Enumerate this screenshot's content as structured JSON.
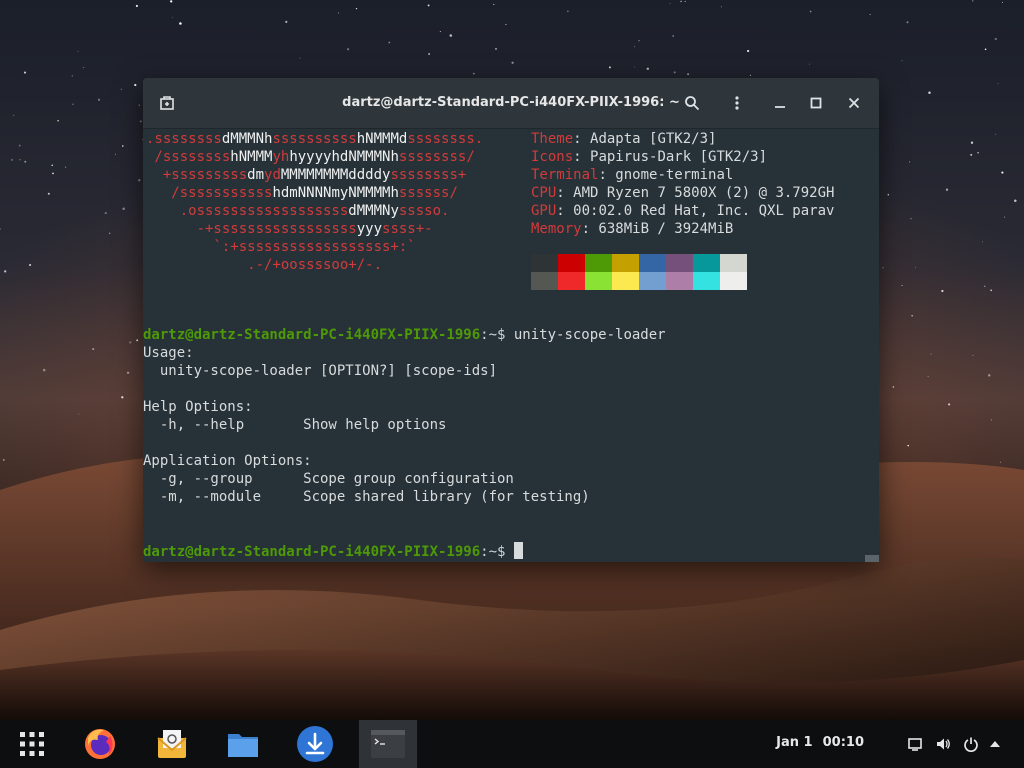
{
  "window": {
    "title": "dartz@dartz-Standard-PC-i440FX-PIIX-1996: ~"
  },
  "neofetch": {
    "logo_lines": [
      {
        "parts": [
          {
            "t": ".ssssssss",
            "c": "red"
          },
          {
            "t": "dMMMNh",
            "c": "white"
          },
          {
            "t": "ssssssssss",
            "c": "red"
          },
          {
            "t": "hNMMMd",
            "c": "white"
          },
          {
            "t": "ssssssss.",
            "c": "red"
          }
        ]
      },
      {
        "parts": [
          {
            "t": " /ssssssss",
            "c": "red"
          },
          {
            "t": "hNMMM",
            "c": "white"
          },
          {
            "t": "yh",
            "c": "red"
          },
          {
            "t": "hyyyyhdNMMMNh",
            "c": "white"
          },
          {
            "t": "ssssssss/",
            "c": "red"
          }
        ]
      },
      {
        "parts": [
          {
            "t": "  +sssssssss",
            "c": "red"
          },
          {
            "t": "dm",
            "c": "white"
          },
          {
            "t": "yd",
            "c": "red"
          },
          {
            "t": "MMMMMMMMddddy",
            "c": "white"
          },
          {
            "t": "ssssssss+",
            "c": "red"
          }
        ]
      },
      {
        "parts": [
          {
            "t": "   /sssssssssss",
            "c": "red"
          },
          {
            "t": "hdmNNNNmyNMMMMh",
            "c": "white"
          },
          {
            "t": "ssssss/",
            "c": "red"
          }
        ]
      },
      {
        "parts": [
          {
            "t": "    .ossssssssssssssssss",
            "c": "red"
          },
          {
            "t": "dMMMNy",
            "c": "white"
          },
          {
            "t": "sssso.",
            "c": "red"
          }
        ]
      },
      {
        "parts": [
          {
            "t": "      -+sssssssssssssssss",
            "c": "red"
          },
          {
            "t": "yyy",
            "c": "white"
          },
          {
            "t": "ssss+-",
            "c": "red"
          }
        ]
      },
      {
        "parts": [
          {
            "t": "        `:+ssssssssssssssssss+:`",
            "c": "red"
          }
        ]
      },
      {
        "parts": [
          {
            "t": "            .-/+oossssoo+/-.",
            "c": "red"
          }
        ]
      }
    ],
    "info": [
      {
        "label": "Theme",
        "value": ": Adapta [GTK2/3]"
      },
      {
        "label": "Icons",
        "value": ": Papirus-Dark [GTK2/3]"
      },
      {
        "label": "Terminal",
        "value": ": gnome-terminal"
      },
      {
        "label": "CPU",
        "value": ": AMD Ryzen 7 5800X (2) @ 3.792GH"
      },
      {
        "label": "GPU",
        "value": ": 00:02.0 Red Hat, Inc. QXL parav"
      },
      {
        "label": "Memory",
        "value": ": 638MiB / 3924MiB"
      }
    ],
    "palette_top": [
      "#2e3436",
      "#cc0000",
      "#4e9a06",
      "#c4a000",
      "#3465a4",
      "#75507b",
      "#06989a",
      "#d3d7cf"
    ],
    "palette_bottom": [
      "#555753",
      "#ef2929",
      "#8ae234",
      "#fce94f",
      "#729fcf",
      "#ad7fa8",
      "#34e2e2",
      "#eeeeec"
    ]
  },
  "terminal": {
    "prompt_user": "dartz@dartz-Standard-PC-i440FX-PIIX-1996",
    "prompt_sep": ":~$ ",
    "command": "unity-scope-loader",
    "output": [
      "Usage:",
      "  unity-scope-loader [OPTION?] [scope-ids]",
      "",
      "Help Options:",
      "  -h, --help       Show help options",
      "",
      "Application Options:",
      "  -g, --group      Scope group configuration",
      "  -m, --module     Scope shared library (for testing)",
      ""
    ]
  },
  "taskbar": {
    "apps": [
      "app-grid-icon",
      "firefox-icon",
      "mail-icon",
      "files-icon",
      "download-icon",
      "terminal-icon"
    ],
    "date": "Jan 1",
    "time": "00:10"
  }
}
